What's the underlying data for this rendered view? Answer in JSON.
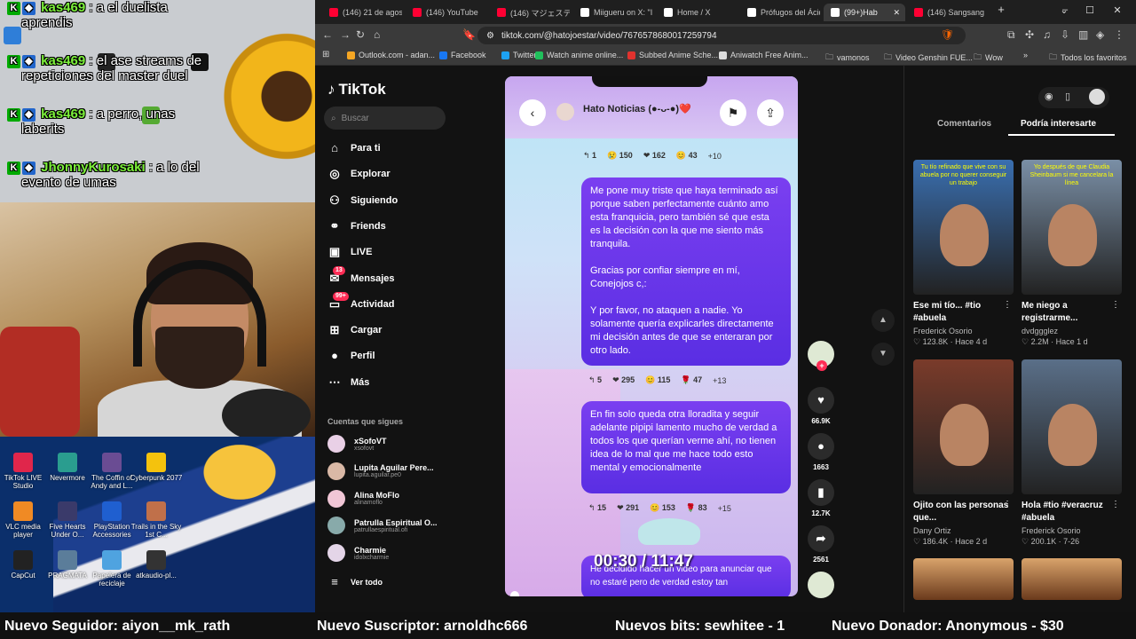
{
  "chat": {
    "messages": [
      {
        "name": "kas469",
        "text": ": a el duelista",
        "cont": "aprendis"
      },
      {
        "name": "kas469",
        "text": ": el ase streams de",
        "cont": "repeticiones del master duel"
      },
      {
        "name": "kas469",
        "text": ": a perro, unas",
        "cont": "laberits"
      },
      {
        "name": "JhonnyKurosaki",
        "text": ": a lo del",
        "cont": "evento de umas"
      }
    ]
  },
  "desktop_icons": [
    "TikTok LIVE Studio",
    "Nevermore",
    "The Coffin of Andy and L...",
    "Cyberpunk 2077",
    "VLC media player",
    "Five Hearts Under O...",
    "PlayStation Accessories",
    "Trails in the Sky 1st C...",
    "CapCut",
    "PRAGMATA",
    "Papelera de reciclaje",
    "atkaudio-pl..."
  ],
  "browser": {
    "tabs": [
      {
        "label": "(146) 21 de agost",
        "color": "#ff0033"
      },
      {
        "label": "(146) YouTube",
        "color": "#ff0033"
      },
      {
        "label": "(146) マジェスティ",
        "color": "#ff0033"
      },
      {
        "label": "Miigueru on X: \"I",
        "color": "#ffffff"
      },
      {
        "label": "Home / X",
        "color": "#ffffff"
      },
      {
        "label": "Prófugos del Ácid",
        "color": "#ffffff"
      },
      {
        "label": "(99+)Hab",
        "color": "#ffffff"
      },
      {
        "label": "(146) Sangsang E",
        "color": "#ff0033"
      }
    ],
    "url": "tiktok.com/@hatojoestar/video/7676578680017259794",
    "bookmarks": [
      {
        "label": "Outlook.com - adan...",
        "color": "#f5a623"
      },
      {
        "label": "Facebook",
        "color": "#1877f2"
      },
      {
        "label": "Twitter",
        "color": "#1da1f2"
      },
      {
        "label": "Watch anime online...",
        "color": "#20c05c"
      },
      {
        "label": "Subbed Anime Sche...",
        "color": "#e0322e"
      },
      {
        "label": "Aniwatch Free Anim...",
        "color": "#dddddd"
      },
      {
        "label": "vamonos",
        "color": "folder"
      },
      {
        "label": "Video Genshin FUE...",
        "color": "folder"
      },
      {
        "label": "Wow",
        "color": "folder"
      }
    ],
    "other_bookmarks": "Todos los favoritos"
  },
  "tiktok": {
    "logo": "TikTok",
    "search_placeholder": "Buscar",
    "nav": [
      {
        "label": "Para ti",
        "icon": "home-icon"
      },
      {
        "label": "Explorar",
        "icon": "compass-icon"
      },
      {
        "label": "Siguiendo",
        "icon": "user-follow-icon"
      },
      {
        "label": "Friends",
        "icon": "friends-icon"
      },
      {
        "label": "LIVE",
        "icon": "live-icon"
      },
      {
        "label": "Mensajes",
        "icon": "message-icon",
        "badge": "13"
      },
      {
        "label": "Actividad",
        "icon": "activity-icon",
        "badge": "99+"
      },
      {
        "label": "Cargar",
        "icon": "upload-icon"
      },
      {
        "label": "Perfil",
        "icon": "profile-icon"
      },
      {
        "label": "Más",
        "icon": "more-icon"
      }
    ],
    "following_title": "Cuentas que sigues",
    "following": [
      {
        "name": "xSofoVT",
        "handle": "xsofovt"
      },
      {
        "name": "Lupita Aguilar Pere...",
        "handle": "lupita.aguilar.pe0"
      },
      {
        "name": "Alina MoFlo",
        "handle": "alinamoflo"
      },
      {
        "name": "Patrulla Espiritual O...",
        "handle": "patrullaespiritual.ofi"
      },
      {
        "name": "Charmie",
        "handle": "idolxcharmie"
      }
    ],
    "see_all": "Ver todo",
    "video": {
      "chat_title": "Hato Noticias (●-ᴗ-●)❤️",
      "reactions_1": [
        "1",
        "150",
        "162",
        "43",
        "+10"
      ],
      "bubble_1_p1": "Me pone muy triste que haya terminado así porque saben perfectamente cuánto amo esta franquicia, pero también sé que esta es la decisión con la que me siento más tranquila.",
      "bubble_1_p2": "Gracias por confiar siempre en mí, Conejojos c,:",
      "bubble_1_p3": "Y por favor, no ataquen a nadie. Yo solamente quería explicarles directamente mi decisión antes de que se enteraran por otro lado.",
      "reactions_2": [
        "5",
        "295",
        "115",
        "47",
        "+13"
      ],
      "bubble_2": "En fin solo queda otra lloradita y seguir adelante pipipi lamento mucho de verdad a todos los que querían verme ahí, no tienen idea de lo mal que me hace todo esto mental y emocionalmente",
      "reactions_3": [
        "15",
        "291",
        "153",
        "83",
        "+15"
      ],
      "bubble_3": "He decidido hacer un video para anunciar que no estaré pero de verdad estoy tan",
      "timer": "00:30 / 11:47"
    },
    "actions": {
      "likes": "66.9K",
      "comments": "1663",
      "saves": "12.7K",
      "shares": "2561"
    },
    "right_tabs": [
      "Comentarios",
      "Podría interesarte"
    ],
    "cards": [
      {
        "caption": "Ese mi tío... #tio #abuela",
        "author": "Frederick Osorio",
        "views": "123.8K",
        "age": "Hace 4 d",
        "overlay": "Tu tío refinado que vive con su abuela por no querer conseguir un trabajo",
        "bg": "#3a6fb0"
      },
      {
        "caption": "Me niego a registrarme...",
        "author": "dvdggglez",
        "views": "2.2M",
        "age": "Hace 1 d",
        "overlay": "Yo después de que Claudia Sheinbaum si me cancelara la línea",
        "bg": "#7a8fa6"
      },
      {
        "caption": "Ojito con las personas que...",
        "author": "Dany Ortiz",
        "views": "186.4K",
        "age": "Hace 2 d",
        "overlay": "",
        "bg": "#7a3b2a"
      },
      {
        "caption": "Hola #tio #veracruz #abuela",
        "author": "Frederick Osorio",
        "views": "200.1K",
        "age": "7-26",
        "overlay": "",
        "bg": "#5a6f88"
      }
    ]
  },
  "ticker": [
    "Nuevo Seguidor: aiyon__mk_rath",
    "Nuevo Suscriptor: arnoldhc666",
    "Nuevos bits: sewhitee - 1",
    "Nuevo Donador: Anonymous - $30"
  ]
}
